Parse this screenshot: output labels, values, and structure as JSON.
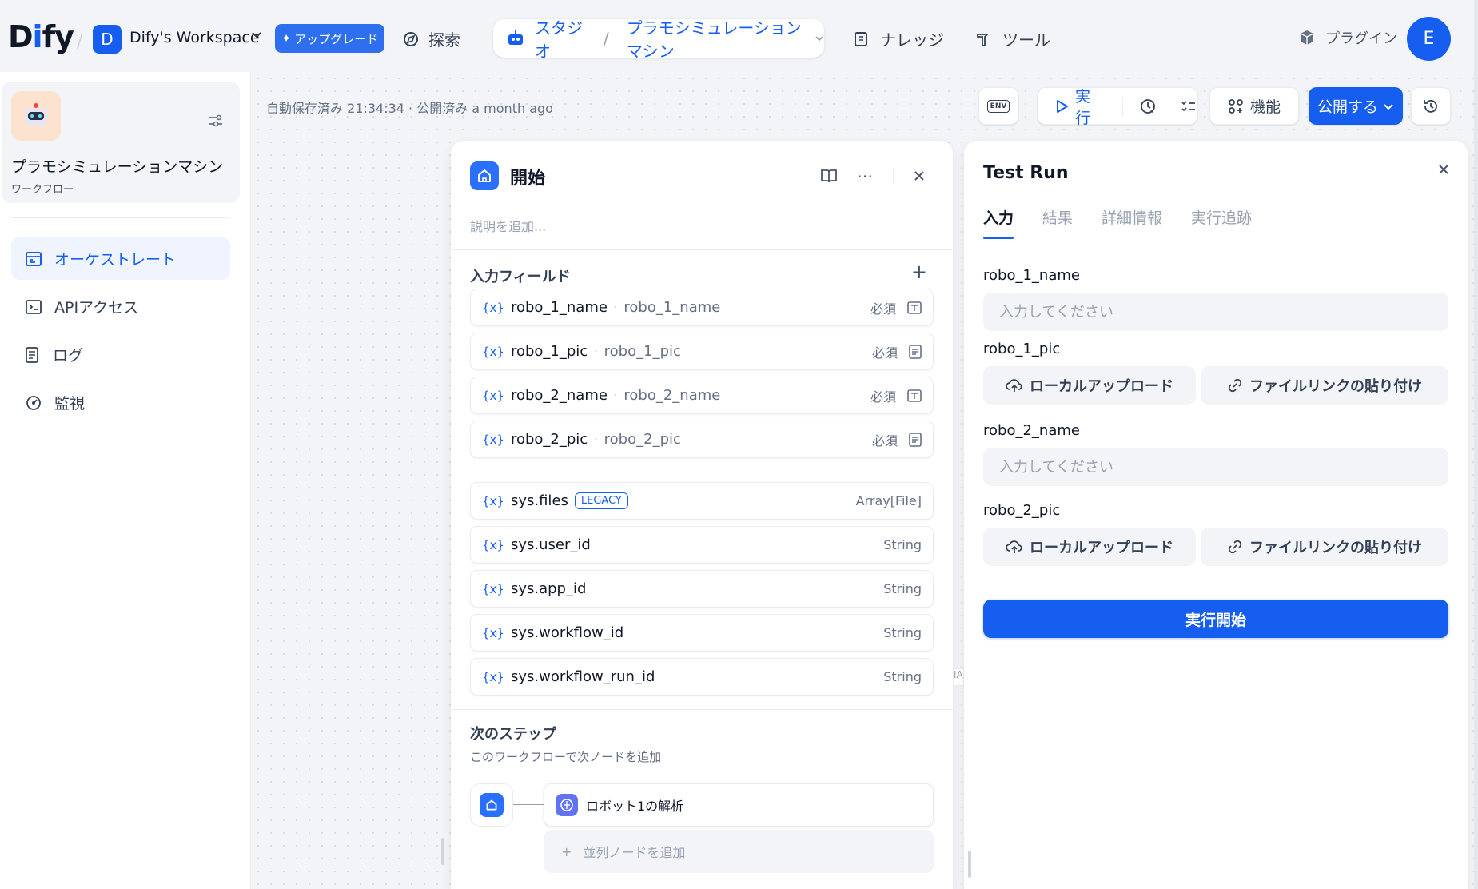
{
  "topbar": {
    "logo": "Dify",
    "workspace_initial": "D",
    "workspace_name": "Dify's Workspace",
    "upgrade_label": "アップグレード",
    "explore_label": "探索",
    "studio_label": "スタジオ",
    "app_crumb": "プラモシミュレーションマシン",
    "knowledge_label": "ナレッジ",
    "tools_label": "ツール",
    "plugins_label": "プラグイン",
    "user_initial": "E"
  },
  "sidebar": {
    "app_name": "プラモシミュレーションマシン",
    "app_type": "ワークフロー",
    "items": [
      {
        "label": "オーケストレート",
        "icon": "orchestrate-icon",
        "active": true
      },
      {
        "label": "APIアクセス",
        "icon": "terminal-icon",
        "active": false
      },
      {
        "label": "ログ",
        "icon": "log-icon",
        "active": false
      },
      {
        "label": "監視",
        "icon": "monitor-icon",
        "active": false
      }
    ]
  },
  "canvas": {
    "autosave": "自動保存済み 21:34:34 · 公開済み a month ago",
    "toolbar": {
      "env_label": "ENV",
      "run_label": "実行",
      "features_label": "機能",
      "publish_label": "公開する"
    }
  },
  "start_panel": {
    "title": "開始",
    "description_placeholder": "説明を追加...",
    "input_fields_title": "入力フィールド",
    "var_symbol": "{x}",
    "fields": [
      {
        "name": "robo_1_name",
        "label": "robo_1_name",
        "required": "必須",
        "icon": "text-input-icon"
      },
      {
        "name": "robo_1_pic",
        "label": "robo_1_pic",
        "required": "必須",
        "icon": "file-input-icon"
      },
      {
        "name": "robo_2_name",
        "label": "robo_2_name",
        "required": "必須",
        "icon": "text-input-icon"
      },
      {
        "name": "robo_2_pic",
        "label": "robo_2_pic",
        "required": "必須",
        "icon": "file-input-icon"
      }
    ],
    "sys_fields": [
      {
        "name": "sys.files",
        "badge": "LEGACY",
        "type": "Array[File]"
      },
      {
        "name": "sys.user_id",
        "type": "String"
      },
      {
        "name": "sys.app_id",
        "type": "String"
      },
      {
        "name": "sys.workflow_id",
        "type": "String"
      },
      {
        "name": "sys.workflow_run_id",
        "type": "String"
      }
    ],
    "next_step_title": "次のステップ",
    "next_step_sub": "このワークフローで次ノードを追加",
    "next_node_label": "ロボット1の解析",
    "add_parallel_label": "並列ノードを追加"
  },
  "test_run": {
    "title": "Test Run",
    "tabs": [
      "入力",
      "結果",
      "詳細情報",
      "実行追跡"
    ],
    "placeholder": "入力してください",
    "labels": {
      "robo_1_name": "robo_1_name",
      "robo_1_pic": "robo_1_pic",
      "robo_2_name": "robo_2_name",
      "robo_2_pic": "robo_2_pic"
    },
    "local_upload_label": "ローカルアップロード",
    "file_link_label": "ファイルリンクの貼り付け",
    "start_label": "実行開始"
  },
  "edge_label": "IA"
}
